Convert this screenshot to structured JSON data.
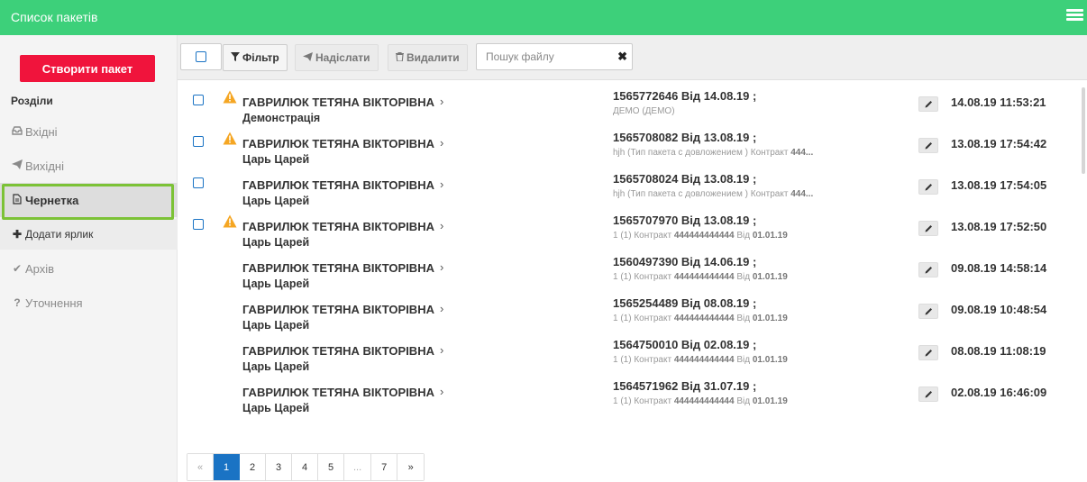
{
  "header": {
    "title": "Список пакетів",
    "menu_icon": "hamburger-icon"
  },
  "sidebar": {
    "create_button": "Створити пакет",
    "section_label": "Розділи",
    "items": [
      {
        "label": "Вхідні",
        "icon": "inbox-icon"
      },
      {
        "label": "Вихідні",
        "icon": "send-icon"
      },
      {
        "label": "Чернетка",
        "icon": "document-icon",
        "active": true
      },
      {
        "label": "Додати ярлик",
        "icon": "plus-icon"
      },
      {
        "label": "Архів",
        "icon": "check-icon"
      },
      {
        "label": "Уточнення",
        "icon": "question-icon"
      }
    ]
  },
  "toolbar": {
    "filter_label": "Фільтр",
    "send_label": "Надіслати",
    "delete_label": "Видалити",
    "search_placeholder": "Пошук файлу"
  },
  "rows": [
    {
      "name": "ГАВРИЛЮК ТЕТЯНА ВІКТОРІВНА",
      "sub": "Демонстрація",
      "num": "1565772646 Від 14.08.19 ;",
      "desc_plain": "ДЕМО (ДЕМО)",
      "desc_mid": "",
      "desc_bold": "",
      "desc_tail": "",
      "desc_bold2": "",
      "date": "14.08.19 11:53:21",
      "warn": true,
      "checkbox": true
    },
    {
      "name": "ГАВРИЛЮК ТЕТЯНА ВІКТОРІВНА",
      "sub": "Царь Царей",
      "num": "1565708082 Від 13.08.19 ;",
      "desc_plain": "hjh (Тип пакета с довложением ) Контракт ",
      "desc_mid": "",
      "desc_bold": "444...",
      "desc_tail": "",
      "desc_bold2": "",
      "date": "13.08.19 17:54:42",
      "warn": true,
      "checkbox": true
    },
    {
      "name": "ГАВРИЛЮК ТЕТЯНА ВІКТОРІВНА",
      "sub": "Царь Царей",
      "num": "1565708024 Від 13.08.19 ;",
      "desc_plain": "hjh (Тип пакета с довложением ) Контракт ",
      "desc_mid": "",
      "desc_bold": "444...",
      "desc_tail": "",
      "desc_bold2": "",
      "date": "13.08.19 17:54:05",
      "warn": false,
      "checkbox": true
    },
    {
      "name": "ГАВРИЛЮК ТЕТЯНА ВІКТОРІВНА",
      "sub": "Царь Царей",
      "num": "1565707970 Від 13.08.19 ;",
      "desc_plain": "1 (1) Контракт ",
      "desc_mid": "",
      "desc_bold": "444444444444",
      "desc_tail": " Від ",
      "desc_bold2": "01.01.19",
      "date": "13.08.19 17:52:50",
      "warn": true,
      "checkbox": true
    },
    {
      "name": "ГАВРИЛЮК ТЕТЯНА ВІКТОРІВНА",
      "sub": "Царь Царей",
      "num": "1560497390 Від 14.06.19 ;",
      "desc_plain": "1 (1) Контракт ",
      "desc_mid": "",
      "desc_bold": "444444444444",
      "desc_tail": " Від ",
      "desc_bold2": "01.01.19",
      "date": "09.08.19 14:58:14",
      "warn": false,
      "checkbox": false
    },
    {
      "name": "ГАВРИЛЮК ТЕТЯНА ВІКТОРІВНА",
      "sub": "Царь Царей",
      "num": "1565254489 Від 08.08.19 ;",
      "desc_plain": "1 (1) Контракт ",
      "desc_mid": "",
      "desc_bold": "444444444444",
      "desc_tail": " Від ",
      "desc_bold2": "01.01.19",
      "date": "09.08.19 10:48:54",
      "warn": false,
      "checkbox": false
    },
    {
      "name": "ГАВРИЛЮК ТЕТЯНА ВІКТОРІВНА",
      "sub": "Царь Царей",
      "num": "1564750010 Від 02.08.19 ;",
      "desc_plain": "1 (1) Контракт ",
      "desc_mid": "",
      "desc_bold": "444444444444",
      "desc_tail": " Від ",
      "desc_bold2": "01.01.19",
      "date": "08.08.19 11:08:19",
      "warn": false,
      "checkbox": false
    },
    {
      "name": "ГАВРИЛЮК ТЕТЯНА ВІКТОРІВНА",
      "sub": "Царь Царей",
      "num": "1564571962 Від 31.07.19 ;",
      "desc_plain": "1 (1) Контракт ",
      "desc_mid": "",
      "desc_bold": "444444444444",
      "desc_tail": " Від ",
      "desc_bold2": "01.01.19",
      "date": "02.08.19 16:46:09",
      "warn": false,
      "checkbox": false
    }
  ],
  "pagination": {
    "prev": "«",
    "pages": [
      "1",
      "2",
      "3",
      "4",
      "5",
      "...",
      "7"
    ],
    "next": "»",
    "active": "1"
  },
  "colors": {
    "header": "#3dd07a",
    "create_button": "#f0143c",
    "active_page": "#1a73c4",
    "highlight": "#7cc236",
    "warning": "#f5a623"
  }
}
